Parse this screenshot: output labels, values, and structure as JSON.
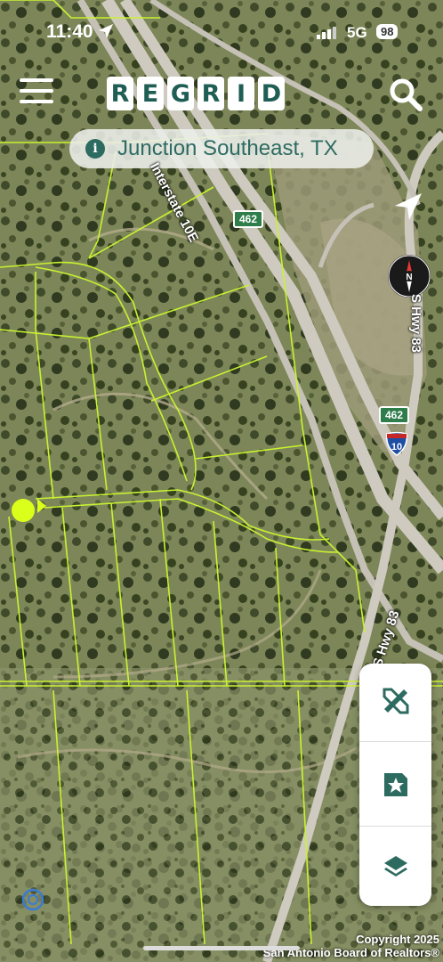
{
  "status_bar": {
    "time": "11:40",
    "network": "5G",
    "battery": "98"
  },
  "header": {
    "logo_letters": [
      "R",
      "E",
      "G",
      "R",
      "I",
      "D"
    ],
    "menu_icon": "hamburger-menu-icon",
    "search_icon": "search-icon"
  },
  "location": {
    "text": "Junction Southeast, TX",
    "icon": "info-icon"
  },
  "map": {
    "road_labels": {
      "interstate": "Interstate 10E",
      "us_hwy_north": "S Hwy 83",
      "us_hwy_south": "S Hwy 83"
    },
    "shields": {
      "exit_462_top": "462",
      "exit_462_right": "462",
      "interstate_number": "10"
    },
    "parcel_line_color": "#c8f230",
    "marker_color": "#d9ff1a"
  },
  "tools": {
    "measure_icon": "ruler-pencil-icon",
    "saved_icon": "bookmark-star-icon",
    "layers_icon": "layers-icon"
  },
  "footer": {
    "copyright_line1": "Copyright 2025",
    "copyright_line2": "San Antonio Board of Realtors®"
  },
  "colors": {
    "brand": "#1f5e54",
    "accent": "#2d6b61"
  }
}
